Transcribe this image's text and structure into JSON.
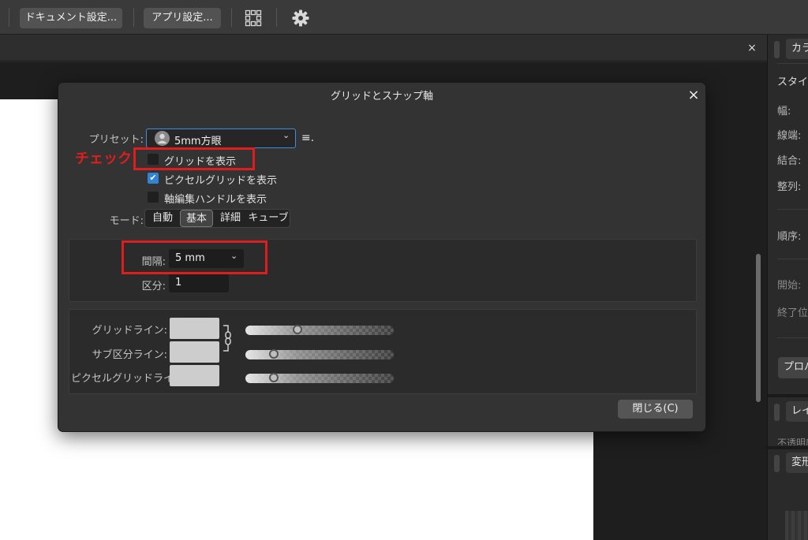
{
  "toolbar": {
    "document_settings": "ドキュメント設定...",
    "app_settings": "アプリ設定...",
    "icons": [
      "snapping-grid-icon",
      "gear-icon"
    ]
  },
  "tab_close": "×",
  "right_panel": {
    "color_tab": "カラー",
    "style": "スタイル",
    "width": "幅:",
    "cap": "線端:",
    "join": "結合:",
    "align": "整列:",
    "order": "順序:",
    "start": "開始:",
    "end": "終了位置",
    "properties_button": "プロパティ",
    "layer_tab": "レイヤー",
    "opacity": "不透明度",
    "transform_tab": "変形"
  },
  "dialog": {
    "title": "グリッドとスナップ軸",
    "close_x": "×",
    "preset_label": "プリセット:",
    "preset_value": "5mm方眼",
    "preset_menu": "≡.",
    "show_grid": {
      "label": "グリッドを表示",
      "checked": false
    },
    "pixel_grid": {
      "label": "ピクセルグリッドを表示",
      "checked": true
    },
    "axis_handle": {
      "label": "軸編集ハンドルを表示",
      "checked": false
    },
    "mode_label": "モード:",
    "modes": [
      "自動",
      "基本",
      "詳細",
      "キューブ"
    ],
    "mode_selected": "基本",
    "spacing_label": "間隔:",
    "spacing_value": "5 mm",
    "divisions_label": "区分:",
    "divisions_value": "1",
    "grid_line_label": "グリッドライン:",
    "subdivision_line_label": "サブ区分ライン:",
    "pixel_grid_line_label": "ピクセルグリッドライン:",
    "close_button": "閉じる(C)"
  },
  "annotation": {
    "text": "チェック",
    "color": "#e01d1d"
  },
  "colors": {
    "accent": "#2f84d6",
    "dialog_bg": "#333333"
  }
}
